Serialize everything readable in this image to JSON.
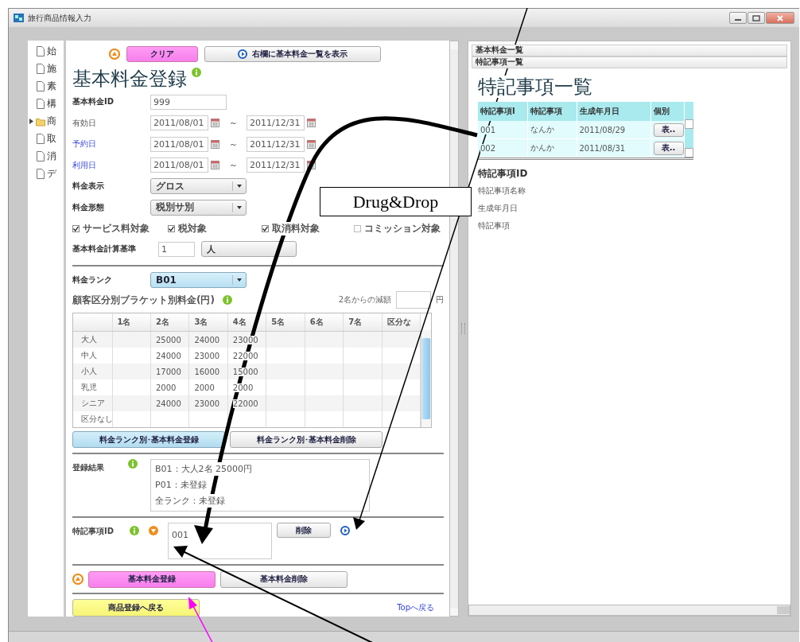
{
  "window": {
    "title": "旅行商品情報入力"
  },
  "tree": [
    {
      "label": "始",
      "kind": "file"
    },
    {
      "label": "施",
      "kind": "file"
    },
    {
      "label": "素",
      "kind": "file"
    },
    {
      "label": "構",
      "kind": "file"
    },
    {
      "label": "商",
      "kind": "folder"
    },
    {
      "label": "取",
      "kind": "file"
    },
    {
      "label": "消",
      "kind": "file"
    },
    {
      "label": "デ",
      "kind": "file"
    }
  ],
  "form": {
    "clear_button": {
      "label": "クリア",
      "kind": "primary"
    },
    "show_list_button": {
      "label": "右欄に基本料金一覧を表示"
    },
    "title": "基本料金登録",
    "id_row": {
      "label": "基本料金ID",
      "value": "999"
    },
    "date_rows": [
      {
        "label": "有効日",
        "link": false,
        "from": "2011/08/01",
        "separator": "～",
        "to": "2011/12/31"
      },
      {
        "label": "予約日",
        "link": true,
        "from": "2011/08/01",
        "separator": "～",
        "to": "2011/12/31"
      },
      {
        "label": "利用日",
        "link": true,
        "from": "2011/08/01",
        "separator": "～",
        "to": "2011/12/31"
      }
    ],
    "selects": [
      {
        "label": "料金表示",
        "value": "グロス"
      },
      {
        "label": "料金形態",
        "value": "税別サ別"
      }
    ],
    "checks": [
      {
        "label": "サービス料対象",
        "checked": true
      },
      {
        "label": "税対象",
        "checked": true
      },
      {
        "label": "取消料対象",
        "checked": true
      },
      {
        "label": "コミッション対象",
        "checked": false
      }
    ],
    "basis": {
      "label": "基本料金計算基準",
      "value": "1",
      "unit": "人"
    },
    "rank": {
      "label": "料金ランク",
      "value": "B01"
    },
    "bracket": {
      "label": "顧客区分別ブラケット別料金(円)",
      "discount_label": "2名からの減額",
      "discount_unit": "円"
    },
    "grid": {
      "columns": [
        "1名",
        "2名",
        "3名",
        "4名",
        "5名",
        "6名",
        "7名",
        "区分な"
      ],
      "rows": [
        {
          "label": "大人",
          "cells": [
            null,
            "25000",
            "24000",
            "23000",
            null,
            null,
            null,
            null
          ]
        },
        {
          "label": "中人",
          "cells": [
            null,
            "24000",
            "23000",
            "22000",
            null,
            null,
            null,
            null
          ]
        },
        {
          "label": "小人",
          "cells": [
            null,
            "17000",
            "16000",
            "15000",
            null,
            null,
            null,
            null
          ]
        },
        {
          "label": "乳児",
          "cells": [
            null,
            "2000",
            "2000",
            "2000",
            null,
            null,
            null,
            null
          ]
        },
        {
          "label": "シニア",
          "cells": [
            null,
            "24000",
            "23000",
            "22000",
            null,
            null,
            null,
            null
          ]
        },
        {
          "label": "区分なし",
          "cells": [
            null,
            null,
            null,
            null,
            null,
            null,
            null,
            null
          ]
        }
      ]
    },
    "rank_buttons": [
      {
        "label": "料金ランク別･基本料金登録",
        "kind": "accent"
      },
      {
        "label": "料金ランク別･基本料金削除",
        "kind": "default"
      }
    ],
    "result": {
      "label": "登録結果",
      "lines": [
        "B01：大人2名 25000円",
        "P01：未登録",
        "全ランク：未登録"
      ]
    },
    "note": {
      "label": "特記事項ID",
      "value": "001",
      "delete_button": "削除"
    },
    "actions": [
      {
        "label": "基本料金登録",
        "kind": "primary"
      },
      {
        "label": "基本料金削除",
        "kind": "default"
      }
    ],
    "back_button": {
      "label": "商品登録へ戻る",
      "kind": "notice"
    },
    "top_link": "Topへ戻る"
  },
  "right": {
    "sections": [
      "基本料金一覧",
      "特記事項一覧"
    ],
    "title": "特記事項一覧",
    "table": {
      "columns": [
        "特記事項I",
        "特記事項",
        "生成年月日",
        "個別"
      ],
      "rows": [
        {
          "id": "001",
          "name": "なんか",
          "date": "2011/08/29",
          "button": "表.."
        },
        {
          "id": "002",
          "name": "かんか",
          "date": "2011/08/31",
          "button": "表.."
        }
      ]
    },
    "details": [
      {
        "label": "特記事項ID",
        "kind": "heading"
      },
      {
        "label": "特記事項名称",
        "kind": "plain"
      },
      {
        "label": "生成年月日",
        "kind": "plain"
      },
      {
        "label": "特記事項",
        "kind": "plain"
      }
    ]
  },
  "annotation": {
    "label": "Drug&Drop"
  }
}
